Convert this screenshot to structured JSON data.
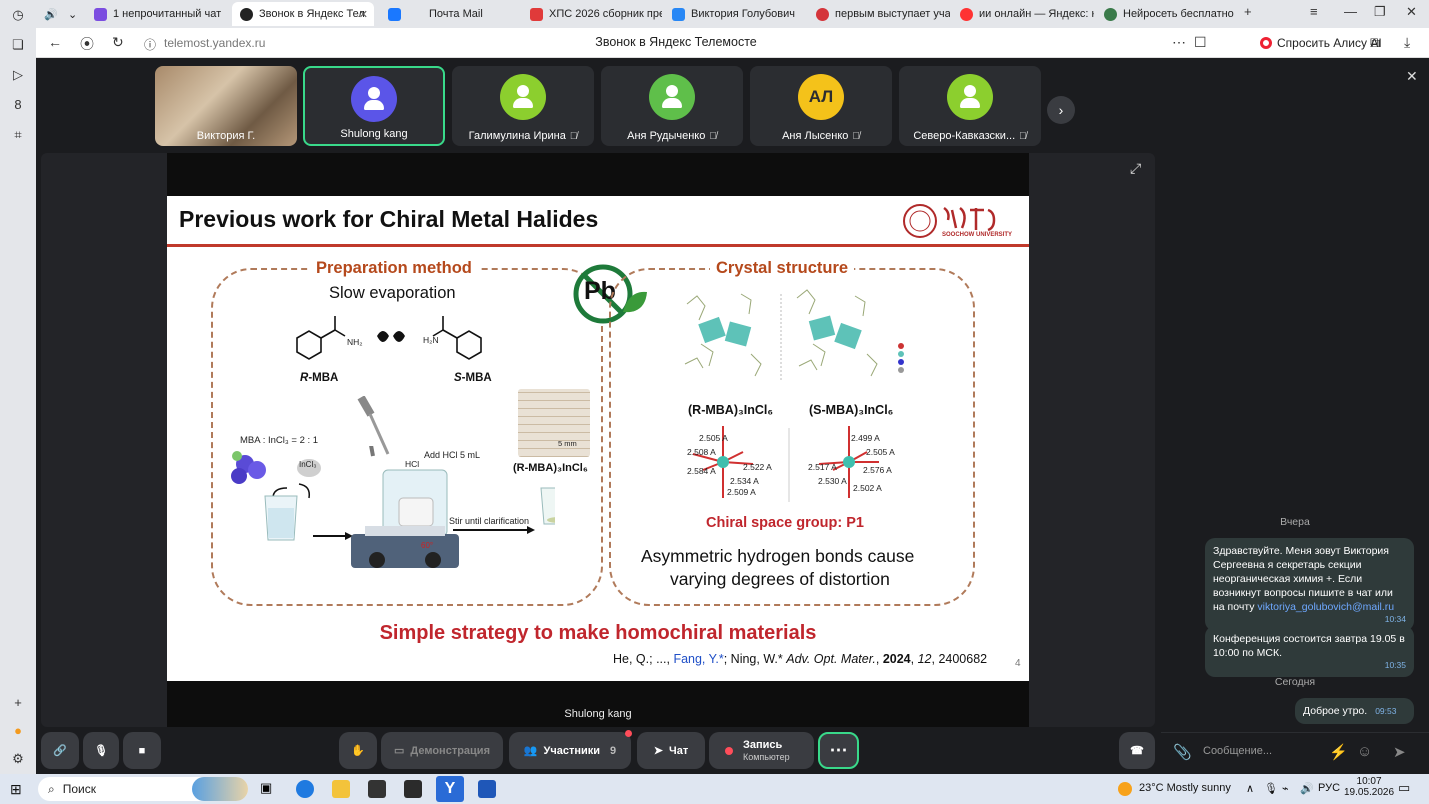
{
  "browser": {
    "tabs": [
      {
        "label": "",
        "active": false
      },
      {
        "label": "1 непрочитанный чат",
        "active": false
      },
      {
        "label": "Звонок в Яндекс Тел",
        "active": true
      },
      {
        "label": "Почта Mail",
        "active": false
      },
      {
        "label": "ХПС 2026 сборник пред",
        "active": false
      },
      {
        "label": "Виктория Голубович",
        "active": false
      },
      {
        "label": "первым выступает учас",
        "active": false
      },
      {
        "label": "ии онлайн — Яндекс: на",
        "active": false
      },
      {
        "label": "Нейросеть бесплатно 2",
        "active": false
      }
    ],
    "url": "telemost.yandex.ru",
    "page_title": "Звонок в Яндекс Телемосте",
    "alice_label": "Спросить Алису AI"
  },
  "participants": [
    {
      "name": "Виктория Г.",
      "type": "video",
      "muted": false,
      "selected": false
    },
    {
      "name": "Shulong kang",
      "type": "avatar",
      "color": "#5b55e8",
      "muted": false,
      "selected": true
    },
    {
      "name": "Галимулина Ирина",
      "type": "avatar",
      "color": "#8ccf2e",
      "muted": true,
      "selected": false
    },
    {
      "name": "Аня Рудыченко",
      "type": "avatar",
      "color": "#5fbf4a",
      "muted": true,
      "selected": false
    },
    {
      "name": "Аня Лысенко",
      "type": "initials",
      "initials": "АЛ",
      "color": "#f4c21a",
      "muted": true,
      "selected": false
    },
    {
      "name": "Северо-Кавказски...",
      "type": "avatar",
      "color": "#8ccf2e",
      "muted": true,
      "selected": false
    }
  ],
  "slide": {
    "title": "Previous work for Chiral Metal Halides",
    "logo_text": "SOOCHOW UNIVERSITY",
    "pb_label": "Pb",
    "left_panel": {
      "title": "Preparation method",
      "subtitle": "Slow evaporation",
      "r_label": "R",
      "s_label": "S",
      "mba_suffix": "-MBA",
      "nh2": "NH₂",
      "h2n": "H₂N",
      "ratio": "MBA : InCl₃ = 2 : 1",
      "incl3": "InCl₃",
      "hcl": "HCl",
      "add_hcl": "Add HCl 5 mL",
      "product": "(R-MBA)₃InCl₆",
      "scale": "5 mm",
      "stir": "Stir until clarification",
      "temp": "60°"
    },
    "right_panel": {
      "title": "Crystal structure",
      "r_formula": "(R-MBA)₃InCl₆",
      "s_formula": "(S-MBA)₃InCl₆",
      "r_bonds": [
        "2.505 A",
        "2.508 A",
        "2.584 A",
        "2.522 A",
        "2.534 A",
        "2.509 A"
      ],
      "s_bonds": [
        "2.499 A",
        "2.505 A",
        "2.517 A",
        "2.576 A",
        "2.530 A",
        "2.502 A"
      ],
      "space_group": "Chiral space group: P1",
      "desc_line1": "Asymmetric hydrogen bonds cause",
      "desc_line2": "varying degrees of distortion"
    },
    "strategy": "Simple strategy to make homochiral materials",
    "citation": {
      "authors_a": "He, Q.; ..., ",
      "authors_blue": "Fang, Y.*",
      "authors_b": "; Ning, W.* ",
      "journal": "Adv. Opt. Mater.",
      "year": "2024",
      "volume": "12",
      "article": "2400682"
    },
    "page_number": "4"
  },
  "speaker_label": "Shulong kang",
  "controls": {
    "demo": "Демонстрация",
    "participants": "Участники",
    "participants_count": "9",
    "chat": "Чат",
    "record": "Запись",
    "record_sub": "Компьютер"
  },
  "chat": {
    "day1": "Вчера",
    "msg1_text": "Здравствуйте. Меня зовут Виктория Сергеевна я секретарь секции неорганическая химия +. Если возникнут вопросы пишите в чат или на почту ",
    "msg1_mail": "viktoriya_golubovich@mail.ru",
    "msg1_time": "10:34",
    "msg2_text": "Конференция состоится завтра 19.05 в 10:00 по МСК.",
    "msg2_time": "10:35",
    "day2": "Сегодня",
    "msg3_text": "Доброе утро.",
    "msg3_time": "09:53",
    "input_placeholder": "Сообщение..."
  },
  "taskbar": {
    "search": "Поиск",
    "weather": "23°C  Mostly sunny",
    "lang": "РУС",
    "time": "10:07",
    "date": "19.05.2026"
  },
  "colors": {
    "accent_green": "#39d98a",
    "slide_red": "#c0262d",
    "heading_orange": "#b5491c"
  }
}
